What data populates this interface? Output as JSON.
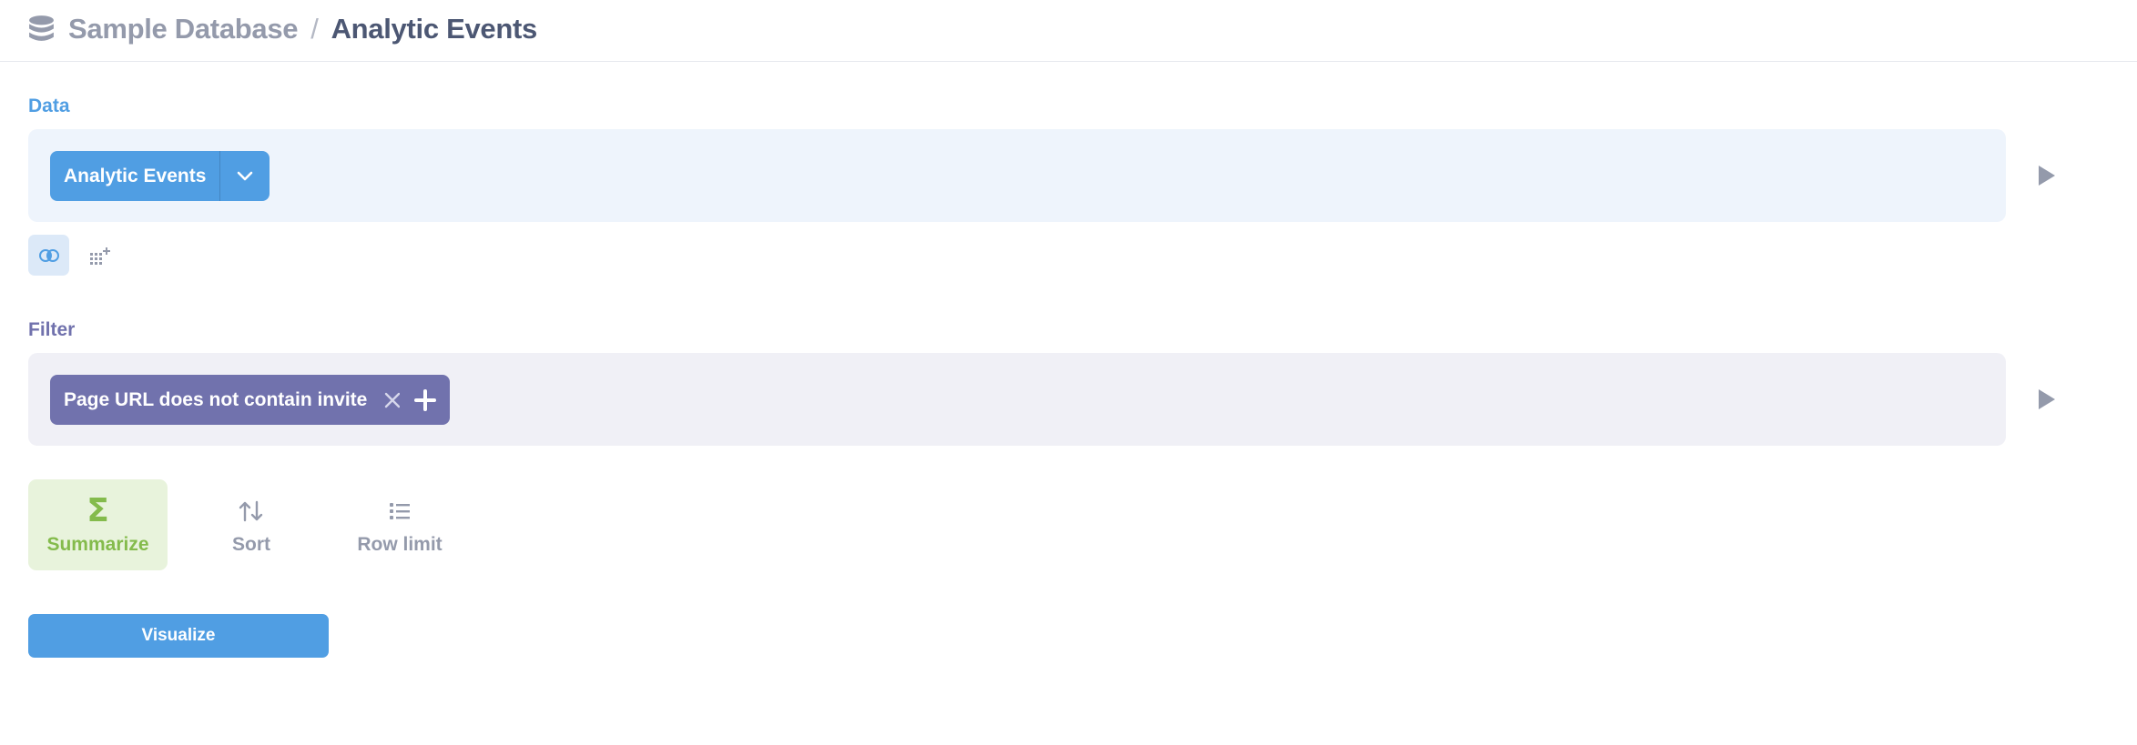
{
  "header": {
    "db_icon": "database-icon",
    "database_name": "Sample Database",
    "separator": "/",
    "table_name": "Analytic Events"
  },
  "data_step": {
    "label": "Data",
    "table_label": "Analytic Events",
    "dropdown_icon": "chevron-down-icon",
    "run_icon": "play-icon",
    "join_icon": "join-icon",
    "custom_column_icon": "grid-plus-icon"
  },
  "filter_step": {
    "label": "Filter",
    "filters": [
      {
        "label": "Page URL does not contain invite"
      }
    ],
    "remove_icon": "close-icon",
    "add_icon": "plus-icon",
    "run_icon": "play-icon"
  },
  "actions": {
    "summarize": {
      "label": "Summarize",
      "icon": "sigma-icon",
      "symbol": "Σ"
    },
    "sort": {
      "label": "Sort",
      "icon": "sort-icon"
    },
    "row_limit": {
      "label": "Row limit",
      "icon": "list-icon"
    }
  },
  "visualize": {
    "label": "Visualize"
  },
  "colors": {
    "brand": "#509ee3",
    "filter": "#7172ad",
    "summarize": "#84bb4c",
    "text_dark": "#4c5773",
    "text_muted": "#949aab"
  }
}
